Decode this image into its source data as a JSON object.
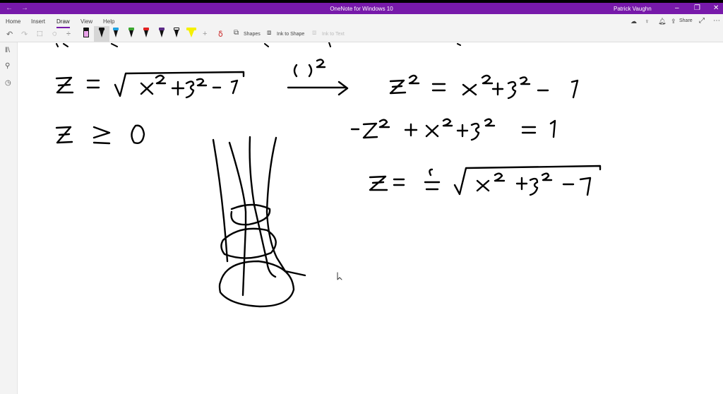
{
  "window": {
    "title": "OneNote for Windows 10",
    "user": "Patrick Vaughn",
    "controls": [
      "minimize",
      "restore",
      "close"
    ]
  },
  "ribbon": {
    "tabs": [
      {
        "label": "Home"
      },
      {
        "label": "Insert"
      },
      {
        "label": "Draw",
        "active": true
      },
      {
        "label": "View"
      },
      {
        "label": "Help"
      }
    ],
    "tools": {
      "shapes": "Shapes",
      "ink_to_shape": "Ink to Shape",
      "ink_to_text": "Ink to Text",
      "share": "Share"
    },
    "pens": [
      "#e9a3e9",
      "#111111",
      "#1ea0e0",
      "#3aa62f",
      "#e02020",
      "#5b2a86",
      "#111111",
      "#f5f000"
    ]
  },
  "colors": {
    "accent": "#7719aa",
    "ink": "#000000"
  }
}
